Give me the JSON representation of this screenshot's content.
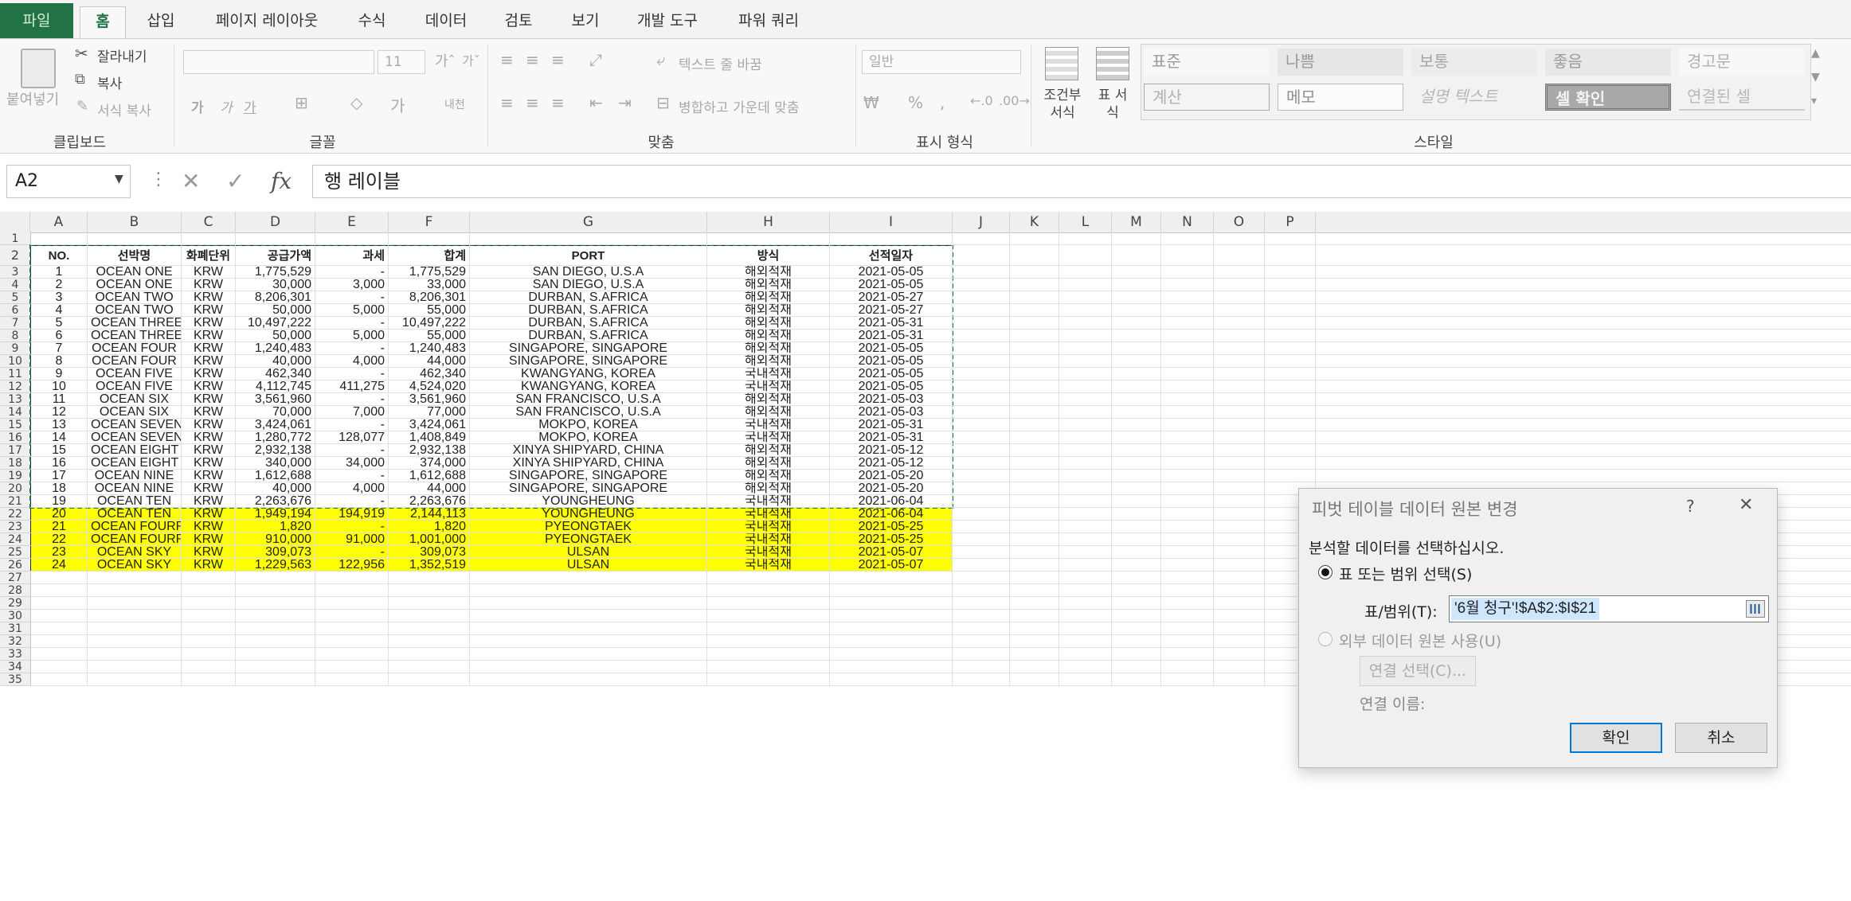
{
  "tabs": [
    "파일",
    "홈",
    "삽입",
    "페이지 레이아웃",
    "수식",
    "데이터",
    "검토",
    "보기",
    "개발 도구",
    "파워 쿼리"
  ],
  "ribbon": {
    "clipboard": {
      "paste": "붙여넣기",
      "cut": "잘라내기",
      "copy": "복사",
      "format_painter": "서식 복사",
      "label": "클립보드"
    },
    "font": {
      "size": "11",
      "label": "글꼴",
      "bold": "가",
      "italic": "가",
      "underline": "가",
      "strike": "내천"
    },
    "align": {
      "wrap": "텍스트 줄 바꿈",
      "merge": "병합하고 가운데 맞춤",
      "label": "맞춤"
    },
    "number": {
      "format": "일반",
      "label": "표시 형식"
    },
    "styles": {
      "cond_fmt": "조건부 서식",
      "table_fmt": "표 서식",
      "label": "스타일",
      "cells": [
        [
          "표준",
          "나쁨",
          "보통",
          "좋음",
          "경고문"
        ],
        [
          "계산",
          "메모",
          "설명 텍스트",
          "셀 확인",
          "연결된 셀"
        ]
      ]
    }
  },
  "formula_bar": {
    "name_box": "A2",
    "formula": "행 레이블"
  },
  "columns": [
    "A",
    "B",
    "C",
    "D",
    "E",
    "F",
    "G",
    "H",
    "I",
    "J",
    "K",
    "L",
    "M",
    "N",
    "O",
    "P"
  ],
  "headers": [
    "NO.",
    "선박명",
    "화폐단위",
    "공급가액",
    "과세",
    "합계",
    "PORT",
    "방식",
    "선적일자"
  ],
  "rows": [
    [
      "1",
      "OCEAN ONE",
      "KRW",
      "1,775,529",
      "-",
      "1,775,529",
      "SAN DIEGO, U.S.A",
      "해외적재",
      "2021-05-05"
    ],
    [
      "2",
      "OCEAN ONE",
      "KRW",
      "30,000",
      "3,000",
      "33,000",
      "SAN DIEGO, U.S.A",
      "해외적재",
      "2021-05-05"
    ],
    [
      "3",
      "OCEAN TWO",
      "KRW",
      "8,206,301",
      "-",
      "8,206,301",
      "DURBAN, S.AFRICA",
      "해외적재",
      "2021-05-27"
    ],
    [
      "4",
      "OCEAN TWO",
      "KRW",
      "50,000",
      "5,000",
      "55,000",
      "DURBAN, S.AFRICA",
      "해외적재",
      "2021-05-27"
    ],
    [
      "5",
      "OCEAN THREE",
      "KRW",
      "10,497,222",
      "-",
      "10,497,222",
      "DURBAN, S.AFRICA",
      "해외적재",
      "2021-05-31"
    ],
    [
      "6",
      "OCEAN THREE",
      "KRW",
      "50,000",
      "5,000",
      "55,000",
      "DURBAN, S.AFRICA",
      "해외적재",
      "2021-05-31"
    ],
    [
      "7",
      "OCEAN FOUR",
      "KRW",
      "1,240,483",
      "-",
      "1,240,483",
      "SINGAPORE, SINGAPORE",
      "해외적재",
      "2021-05-05"
    ],
    [
      "8",
      "OCEAN FOUR",
      "KRW",
      "40,000",
      "4,000",
      "44,000",
      "SINGAPORE, SINGAPORE",
      "해외적재",
      "2021-05-05"
    ],
    [
      "9",
      "OCEAN FIVE",
      "KRW",
      "462,340",
      "-",
      "462,340",
      "KWANGYANG, KOREA",
      "국내적재",
      "2021-05-05"
    ],
    [
      "10",
      "OCEAN FIVE",
      "KRW",
      "4,112,745",
      "411,275",
      "4,524,020",
      "KWANGYANG, KOREA",
      "국내적재",
      "2021-05-05"
    ],
    [
      "11",
      "OCEAN SIX",
      "KRW",
      "3,561,960",
      "-",
      "3,561,960",
      "SAN FRANCISCO, U.S.A",
      "해외적재",
      "2021-05-03"
    ],
    [
      "12",
      "OCEAN SIX",
      "KRW",
      "70,000",
      "7,000",
      "77,000",
      "SAN FRANCISCO, U.S.A",
      "해외적재",
      "2021-05-03"
    ],
    [
      "13",
      "OCEAN SEVEN",
      "KRW",
      "3,424,061",
      "-",
      "3,424,061",
      "MOKPO, KOREA",
      "국내적재",
      "2021-05-31"
    ],
    [
      "14",
      "OCEAN SEVEN",
      "KRW",
      "1,280,772",
      "128,077",
      "1,408,849",
      "MOKPO, KOREA",
      "국내적재",
      "2021-05-31"
    ],
    [
      "15",
      "OCEAN EIGHT",
      "KRW",
      "2,932,138",
      "-",
      "2,932,138",
      "XINYA SHIPYARD, CHINA",
      "해외적재",
      "2021-05-12"
    ],
    [
      "16",
      "OCEAN EIGHT",
      "KRW",
      "340,000",
      "34,000",
      "374,000",
      "XINYA SHIPYARD, CHINA",
      "해외적재",
      "2021-05-12"
    ],
    [
      "17",
      "OCEAN NINE",
      "KRW",
      "1,612,688",
      "-",
      "1,612,688",
      "SINGAPORE, SINGAPORE",
      "해외적재",
      "2021-05-20"
    ],
    [
      "18",
      "OCEAN NINE",
      "KRW",
      "40,000",
      "4,000",
      "44,000",
      "SINGAPORE, SINGAPORE",
      "해외적재",
      "2021-05-20"
    ],
    [
      "19",
      "OCEAN TEN",
      "KRW",
      "2,263,676",
      "-",
      "2,263,676",
      "YOUNGHEUNG",
      "국내적재",
      "2021-06-04"
    ],
    [
      "20",
      "OCEAN TEN",
      "KRW",
      "1,949,194",
      "194,919",
      "2,144,113",
      "YOUNGHEUNG",
      "국내적재",
      "2021-06-04"
    ],
    [
      "21",
      "OCEAN FOURRISE",
      "KRW",
      "1,820",
      "-",
      "1,820",
      "PYEONGTAEK",
      "국내적재",
      "2021-05-25"
    ],
    [
      "22",
      "OCEAN FOURRISE",
      "KRW",
      "910,000",
      "91,000",
      "1,001,000",
      "PYEONGTAEK",
      "국내적재",
      "2021-05-25"
    ],
    [
      "23",
      "OCEAN SKY",
      "KRW",
      "309,073",
      "-",
      "309,073",
      "ULSAN",
      "국내적재",
      "2021-05-07"
    ],
    [
      "24",
      "OCEAN SKY",
      "KRW",
      "1,229,563",
      "122,956",
      "1,352,519",
      "ULSAN",
      "국내적재",
      "2021-05-07"
    ]
  ],
  "highlight_color": "#ffff00",
  "dialog": {
    "title": "피벗 테이블 데이터 원본 변경",
    "help": "?",
    "close": "✕",
    "instruction": "분석할 데이터를 선택하십시오.",
    "option_range": "표 또는 범위 선택(S)",
    "range_label": "표/범위(T):",
    "range_value": "'6월 청구'!$A$2:$I$21",
    "option_external": "외부 데이터 원본 사용(U)",
    "choose_conn": "연결 선택(C)...",
    "conn_name": "연결 이름:",
    "ok": "확인",
    "cancel": "취소"
  }
}
